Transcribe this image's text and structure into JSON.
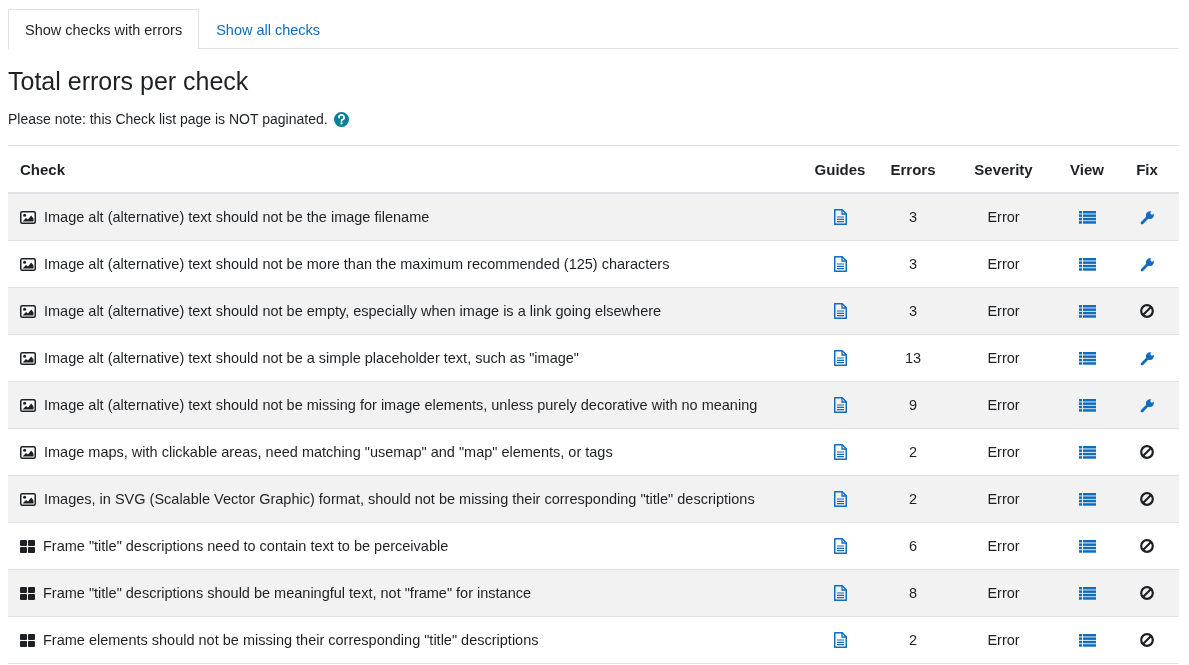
{
  "tabs": [
    {
      "label": "Show checks with errors",
      "selected": true
    },
    {
      "label": "Show all checks",
      "selected": false
    }
  ],
  "title": "Total errors per check",
  "note": "Please note: this Check list page is NOT paginated.",
  "table": {
    "columns": [
      "Check",
      "Guides",
      "Errors",
      "Severity",
      "View",
      "Fix"
    ],
    "rows": [
      {
        "kind": "image",
        "check": "Image alt (alternative) text should not be the image filename",
        "errors": "3",
        "severity": "Error",
        "fixable": true
      },
      {
        "kind": "image",
        "check": "Image alt (alternative) text should not be more than the maximum recommended (125) characters",
        "errors": "3",
        "severity": "Error",
        "fixable": true
      },
      {
        "kind": "image",
        "check": "Image alt (alternative) text should not be empty, especially when image is a link going elsewhere",
        "errors": "3",
        "severity": "Error",
        "fixable": false
      },
      {
        "kind": "image",
        "check": "Image alt (alternative) text should not be a simple placeholder text, such as \"image\"",
        "errors": "13",
        "severity": "Error",
        "fixable": true
      },
      {
        "kind": "image",
        "check": "Image alt (alternative) text should not be missing for image elements, unless purely decorative with no meaning",
        "errors": "9",
        "severity": "Error",
        "fixable": true
      },
      {
        "kind": "image",
        "check": "Image maps, with clickable areas, need matching \"usemap\" and \"map\" elements, or tags",
        "errors": "2",
        "severity": "Error",
        "fixable": false
      },
      {
        "kind": "image",
        "check": "Images, in SVG (Scalable Vector Graphic) format, should not be missing their corresponding \"title\" descriptions",
        "errors": "2",
        "severity": "Error",
        "fixable": false
      },
      {
        "kind": "frame",
        "check": "Frame \"title\" descriptions need to contain text to be perceivable",
        "errors": "6",
        "severity": "Error",
        "fixable": false
      },
      {
        "kind": "frame",
        "check": "Frame \"title\" descriptions should be meaningful text, not \"frame\" for instance",
        "errors": "8",
        "severity": "Error",
        "fixable": false
      },
      {
        "kind": "frame",
        "check": "Frame elements should not be missing their corresponding \"title\" descriptions",
        "errors": "2",
        "severity": "Error",
        "fixable": false
      }
    ]
  }
}
